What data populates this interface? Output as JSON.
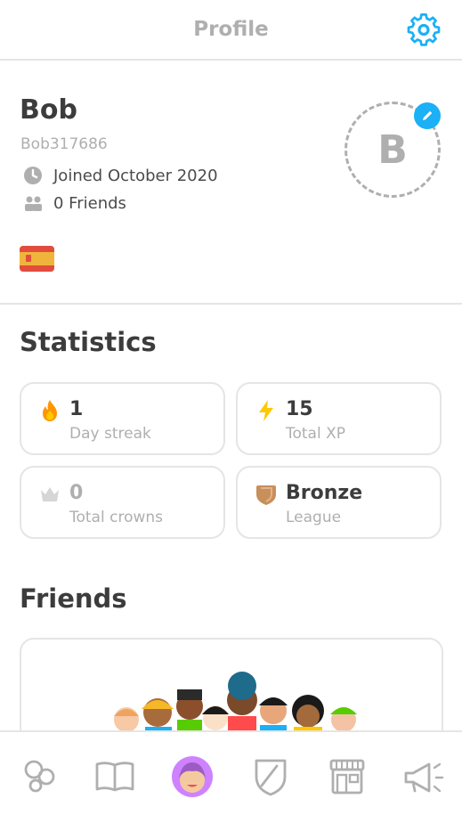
{
  "header": {
    "title": "Profile",
    "settings_icon": "gear-icon"
  },
  "profile": {
    "name": "Bob",
    "username": "Bob317686",
    "joined": "Joined October 2020",
    "friends": "0 Friends",
    "avatar_letter": "B",
    "flag": "spain-flag-icon"
  },
  "statistics": {
    "title": "Statistics",
    "cards": [
      {
        "value": "1",
        "label": "Day streak",
        "icon": "fire-icon"
      },
      {
        "value": "15",
        "label": "Total XP",
        "icon": "lightning-icon"
      },
      {
        "value": "0",
        "label": "Total crowns",
        "icon": "crown-icon"
      },
      {
        "value": "Bronze",
        "label": "League",
        "icon": "bronze-shield-icon"
      }
    ]
  },
  "friends": {
    "title": "Friends"
  },
  "nav": [
    "learn-icon",
    "stories-icon",
    "profile-icon",
    "leaderboard-icon",
    "shop-icon",
    "news-icon"
  ],
  "colors": {
    "accent_blue": "#1cb0f6",
    "profile_purple": "#ce82ff",
    "text_gray": "#afafaf",
    "divider": "#e5e5e5"
  }
}
